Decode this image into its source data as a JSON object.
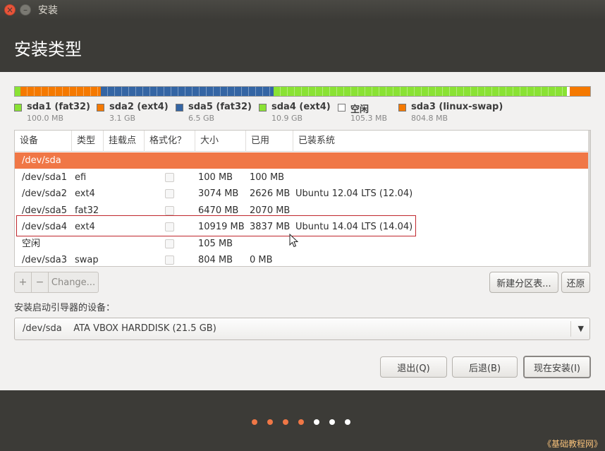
{
  "window": {
    "title": "安装",
    "close_glyph": "×",
    "minimize_glyph": "–"
  },
  "page": {
    "title": "安装类型"
  },
  "partition_bar": [
    {
      "name": "sda1",
      "color": "#8ae234",
      "fraction": 0.01,
      "hatch": false
    },
    {
      "name": "sda2",
      "color": "#f57900",
      "fraction": 0.14,
      "hatch": true
    },
    {
      "name": "sda5",
      "color": "#3465a4",
      "fraction": 0.3,
      "hatch": true
    },
    {
      "name": "sda4",
      "color": "#8ae234",
      "fraction": 0.51,
      "hatch": true
    },
    {
      "name": "free",
      "color": "#ffffff",
      "fraction": 0.005,
      "hatch": false
    },
    {
      "name": "sda3",
      "color": "#f57900",
      "fraction": 0.035,
      "hatch": false
    }
  ],
  "legend": [
    {
      "name": "sda1 (fat32)",
      "size": "100.0 MB",
      "color": "#8ae234"
    },
    {
      "name": "sda2 (ext4)",
      "size": "3.1 GB",
      "color": "#f57900"
    },
    {
      "name": "sda5 (fat32)",
      "size": "6.5 GB",
      "color": "#3465a4"
    },
    {
      "name": "sda4 (ext4)",
      "size": "10.9 GB",
      "color": "#8ae234"
    },
    {
      "name": "空闲",
      "size": "105.3 MB",
      "color": "#ffffff"
    },
    {
      "name": "sda3 (linux-swap)",
      "size": "804.8 MB",
      "color": "#f57900"
    }
  ],
  "table": {
    "headers": [
      "设备",
      "类型",
      "挂载点",
      "格式化？",
      "大小",
      "已用",
      "已装系统"
    ],
    "rows": [
      {
        "device": "/dev/sda",
        "type": "",
        "mount": "",
        "size": "",
        "used": "",
        "system": "",
        "selected": true,
        "checkbox": false
      },
      {
        "device": "/dev/sda1",
        "type": "efi",
        "mount": "",
        "size": "100 MB",
        "used": "100 MB",
        "system": "",
        "selected": false,
        "checkbox": true
      },
      {
        "device": "/dev/sda2",
        "type": "ext4",
        "mount": "",
        "size": "3074 MB",
        "used": "2626 MB",
        "system": "Ubuntu 12.04 LTS (12.04)",
        "selected": false,
        "checkbox": true
      },
      {
        "device": "/dev/sda5",
        "type": "fat32",
        "mount": "",
        "size": "6470 MB",
        "used": "2070 MB",
        "system": "",
        "selected": false,
        "checkbox": true
      },
      {
        "device": "/dev/sda4",
        "type": "ext4",
        "mount": "",
        "size": "10919 MB",
        "used": "3837 MB",
        "system": "Ubuntu 14.04 LTS (14.04)",
        "selected": false,
        "checkbox": true
      },
      {
        "device": "空闲",
        "type": "",
        "mount": "",
        "size": "105 MB",
        "used": "",
        "system": "",
        "selected": false,
        "checkbox": true
      },
      {
        "device": "/dev/sda3",
        "type": "swap",
        "mount": "",
        "size": "804 MB",
        "used": "0 MB",
        "system": "",
        "selected": false,
        "checkbox": true
      }
    ]
  },
  "toolbar": {
    "add": "+",
    "remove": "−",
    "change": "Change...",
    "new_table": "新建分区表...",
    "revert": "还原"
  },
  "boot": {
    "label": "安装启动引导器的设备：",
    "value": "/dev/sda    ATA VBOX HARDDISK (21.5 GB)",
    "arrow": "▼"
  },
  "actions": {
    "quit": "退出(Q)",
    "back": "后退(B)",
    "install_now": "现在安装(I)"
  },
  "progress_dots": [
    {
      "color": "#f07746"
    },
    {
      "color": "#f07746"
    },
    {
      "color": "#f07746"
    },
    {
      "color": "#f07746"
    },
    {
      "color": "#ffffff"
    },
    {
      "color": "#ffffff"
    },
    {
      "color": "#ffffff"
    }
  ],
  "watermark": "《基础教程网》"
}
